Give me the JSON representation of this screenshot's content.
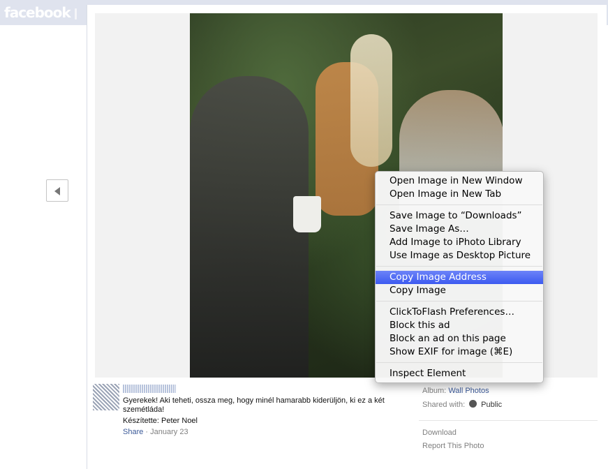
{
  "header": {
    "logo": "facebook"
  },
  "caption": {
    "text": "Gyerekek! Aki teheti, ossza meg, hogy minél hamarabb kiderüljön, ki ez a két szemétláda!",
    "author_line": "Készítette: Peter Noel",
    "share_label": "Share",
    "separator": "·",
    "date": "January 23"
  },
  "info": {
    "album_label": "Album:",
    "album_value": "Wall Photos",
    "shared_label": "Shared with:",
    "shared_value": "Public",
    "download": "Download",
    "report": "Report This Photo"
  },
  "context_menu": {
    "items": [
      "Open Image in New Window",
      "Open Image in New Tab",
      "Save Image to “Downloads”",
      "Save Image As…",
      "Add Image to iPhoto Library",
      "Use Image as Desktop Picture",
      "Copy Image Address",
      "Copy Image",
      "ClickToFlash Preferences…",
      "Block this ad",
      "Block an ad on this page",
      "Show EXIF for image (⌘E)",
      "Inspect Element"
    ],
    "selected": "Copy Image Address"
  },
  "icons": {
    "prev": "chevron-left-icon",
    "privacy": "globe-icon"
  }
}
